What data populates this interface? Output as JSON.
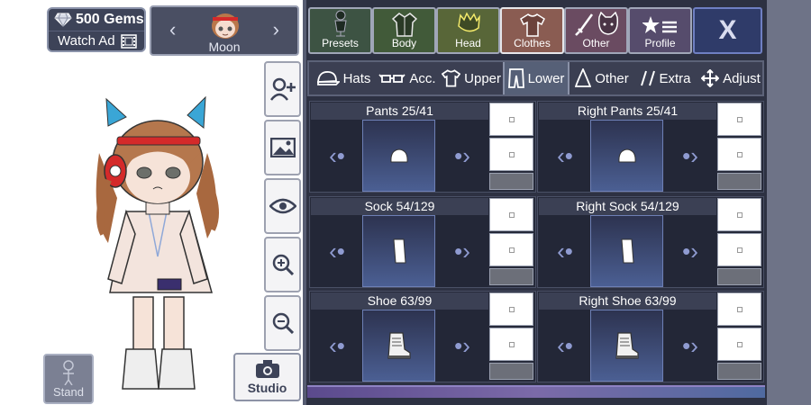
{
  "top_left": {
    "gems_label": "500 Gems",
    "watch_ad_label": "Watch Ad"
  },
  "character": {
    "name": "Moon",
    "prev_icon": "chevron-left-icon",
    "next_icon": "chevron-right-icon"
  },
  "side_buttons": [
    {
      "name": "add-character-icon"
    },
    {
      "name": "background-icon"
    },
    {
      "name": "eye-icon"
    },
    {
      "name": "zoom-in-icon"
    },
    {
      "name": "zoom-out-icon"
    }
  ],
  "stand_label": "Stand",
  "studio_label": "Studio",
  "categories": [
    {
      "label": "Presets",
      "bg": "#3d5343"
    },
    {
      "label": "Body",
      "bg": "#415a39"
    },
    {
      "label": "Head",
      "bg": "#586638"
    },
    {
      "label": "Clothes",
      "bg": "#8a5c52"
    },
    {
      "label": "Other",
      "bg": "#6a4b61"
    },
    {
      "label": "Profile",
      "bg": "#564c6c"
    }
  ],
  "close_label": "X",
  "subtabs": [
    {
      "label": "Hats"
    },
    {
      "label": "Acc."
    },
    {
      "label": "Upper"
    },
    {
      "label": "Lower"
    },
    {
      "label": "Other"
    },
    {
      "label": "Extra"
    },
    {
      "label": "Adjust"
    }
  ],
  "slots": [
    {
      "title": "Pants 25/41",
      "item": "pants"
    },
    {
      "title": "Right Pants 25/41",
      "item": "pants"
    },
    {
      "title": "Sock 54/129",
      "item": "sock"
    },
    {
      "title": "Right Sock 54/129",
      "item": "sock"
    },
    {
      "title": "Shoe 63/99",
      "item": "shoe"
    },
    {
      "title": "Right Shoe 63/99",
      "item": "shoe"
    }
  ],
  "colors": {
    "panel_bg": "#2d3142",
    "active_tab": "#8a5c52",
    "accent_blue": "#8f9bd1"
  }
}
